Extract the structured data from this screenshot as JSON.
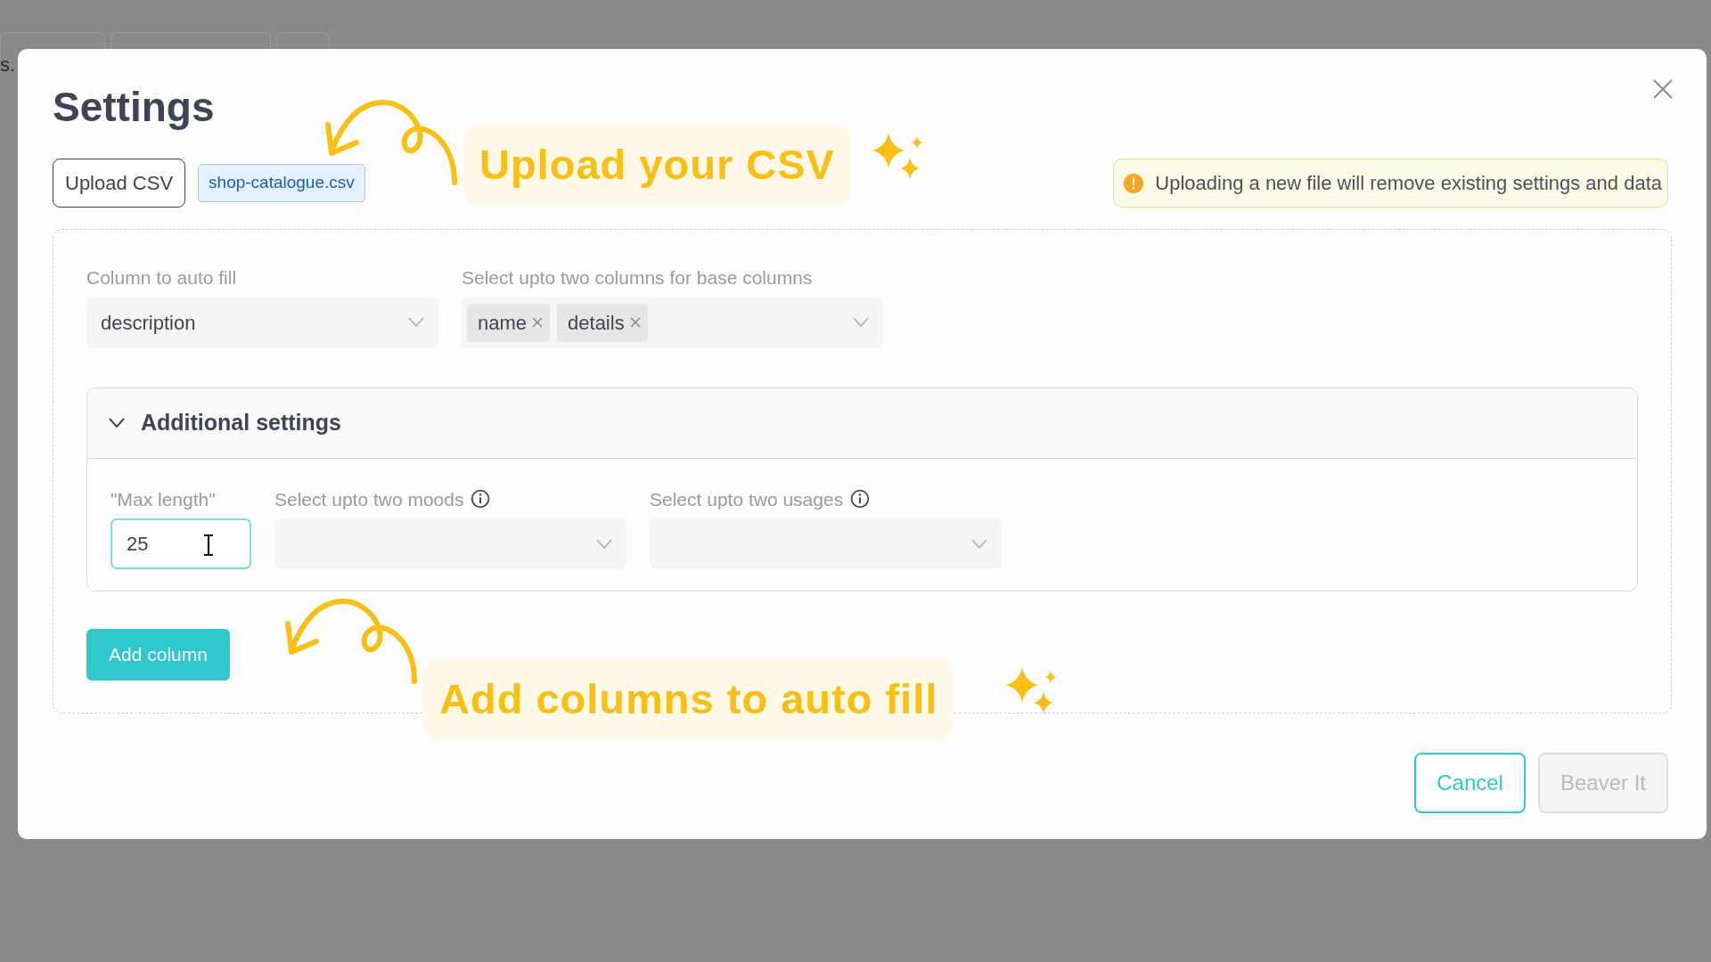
{
  "background": {
    "text_fragment": "s."
  },
  "dialog": {
    "title": "Settings",
    "upload_button": "Upload CSV",
    "file_name": "shop-catalogue.csv",
    "warning": "Uploading a new file will remove existing settings and data",
    "fields": [
      {
        "kind": "single",
        "label": "Column to auto fill",
        "value": "description"
      },
      {
        "kind": "multi",
        "label": "Select upto two columns for base columns",
        "tags": [
          "name",
          "details"
        ]
      }
    ],
    "additional": {
      "title": "Additional settings",
      "expanded": true,
      "fields": [
        {
          "kind": "number",
          "label": "\"Max length\"",
          "value": "25",
          "focused": true
        },
        {
          "kind": "select",
          "label": "Select upto two moods"
        },
        {
          "kind": "select",
          "label": "Select upto two usages"
        }
      ]
    },
    "add_button": "Add column",
    "buttons": [
      {
        "label": "Cancel",
        "disabled": false
      },
      {
        "label": "Beaver It",
        "disabled": true
      }
    ]
  },
  "annotations": [
    {
      "text": "Upload your CSV"
    },
    {
      "text": "Add columns to auto fill"
    }
  ]
}
